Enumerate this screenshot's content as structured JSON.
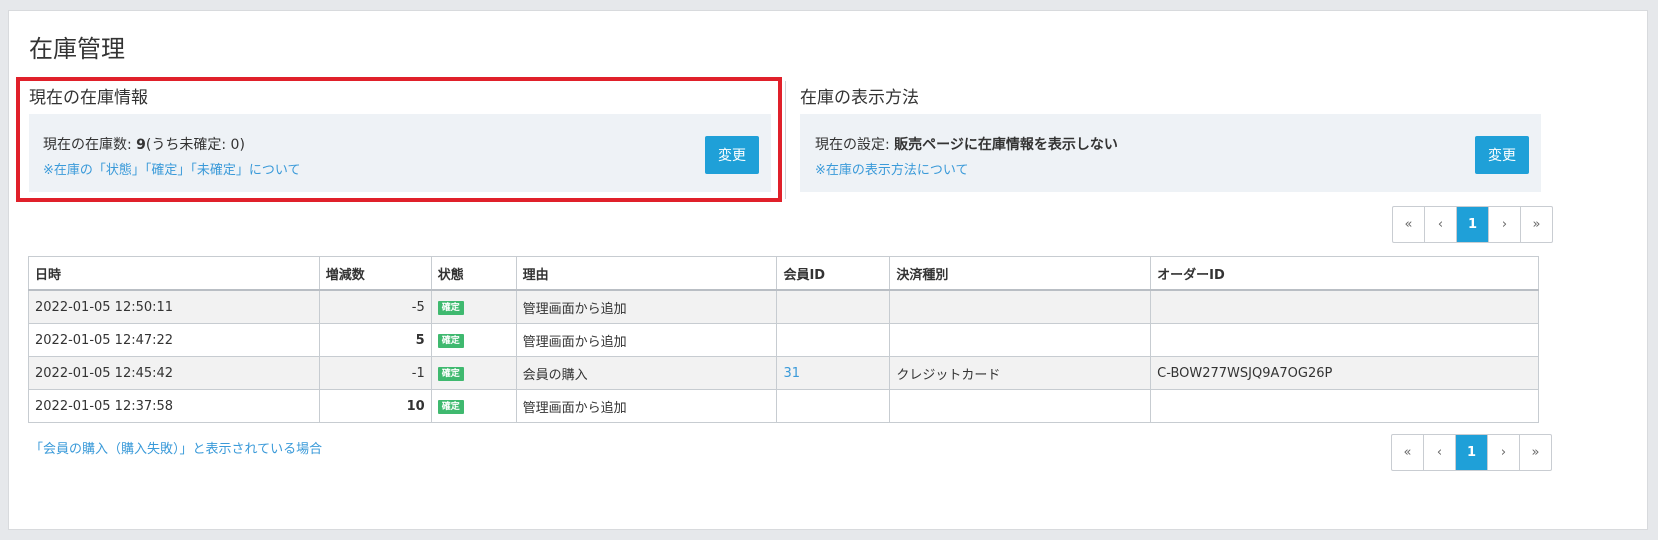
{
  "page_title": "在庫管理",
  "stock_info": {
    "title": "現在の在庫情報",
    "count_label": "現在の在庫数: ",
    "count_value": "9",
    "count_suffix": "(うち未確定: 0)",
    "link": "※在庫の「状態」「確定」「未確定」について",
    "button": "変更"
  },
  "display_method": {
    "title": "在庫の表示方法",
    "setting_label": "現在の設定: ",
    "setting_value": "販売ページに在庫情報を表示しない",
    "link": "※在庫の表示方法について",
    "button": "変更"
  },
  "pagination": {
    "first": "«",
    "prev": "‹",
    "current": "1",
    "next": "›",
    "last": "»"
  },
  "table": {
    "headers": [
      "日時",
      "増減数",
      "状態",
      "理由",
      "会員ID",
      "決済種別",
      "オーダーID"
    ],
    "rows": [
      {
        "datetime": "2022-01-05 12:50:11",
        "change": "-5",
        "status": "確定",
        "reason": "管理画面から追加",
        "member_id": "",
        "payment": "",
        "order_id": ""
      },
      {
        "datetime": "2022-01-05 12:47:22",
        "change": "5",
        "status": "確定",
        "reason": "管理画面から追加",
        "member_id": "",
        "payment": "",
        "order_id": ""
      },
      {
        "datetime": "2022-01-05 12:45:42",
        "change": "-1",
        "status": "確定",
        "reason": "会員の購入",
        "member_id": "31",
        "payment": "クレジットカード",
        "order_id": "C-BOW277WSJQ9A7OG26P"
      },
      {
        "datetime": "2022-01-05 12:37:58",
        "change": "10",
        "status": "確定",
        "reason": "管理画面から追加",
        "member_id": "",
        "payment": "",
        "order_id": ""
      }
    ]
  },
  "footer_link": "「会員の購入（購入失敗）」と表示されている場合",
  "colors": {
    "accent": "#1fa0d8",
    "link": "#3a9ad9",
    "badge": "#3fb96f",
    "highlight": "#e0202a"
  }
}
